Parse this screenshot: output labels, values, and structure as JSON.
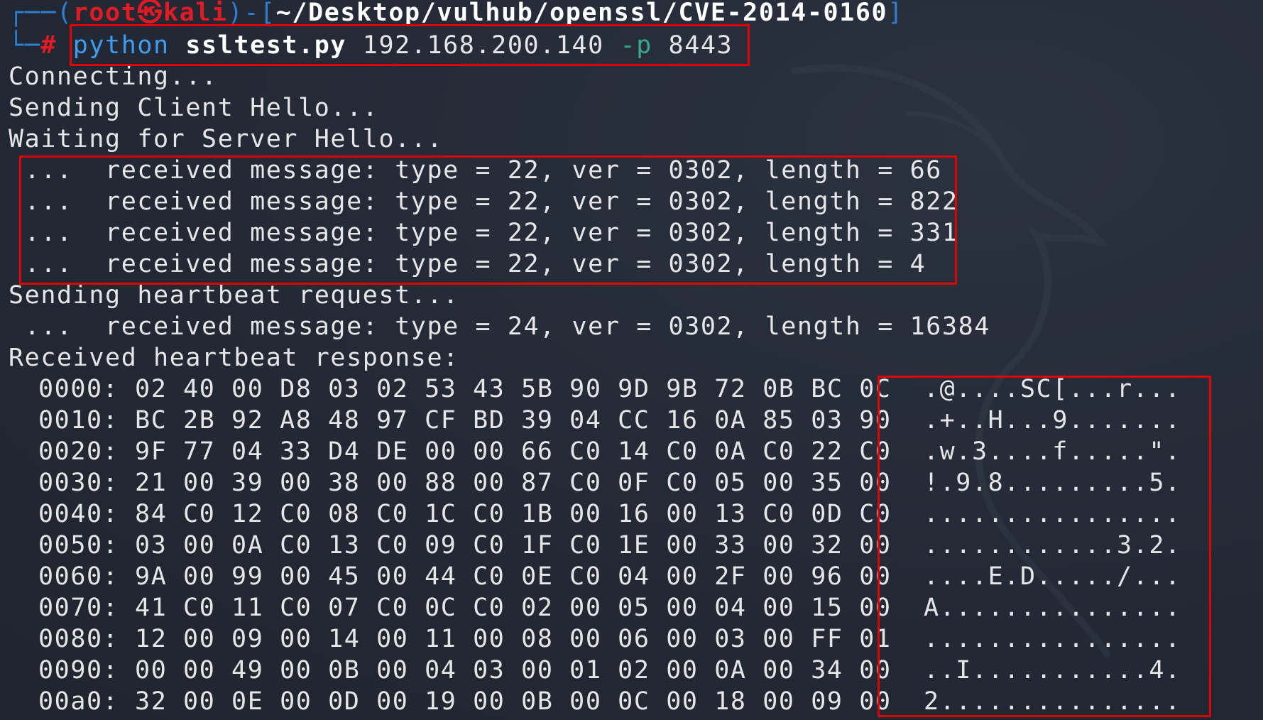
{
  "prompt": {
    "corner_top": "┌──(",
    "user_host": "root㉿kali",
    "bracket_sep": ")-[",
    "cwd": "~/Desktop/vulhub/openssl/CVE-2014-0160",
    "bracket_end": "]",
    "corner_bottom": "└─",
    "hash": "#",
    "command": "python",
    "script": "ssltest.py",
    "target": "192.168.200.140",
    "flag": "-p",
    "port": "8443"
  },
  "output": {
    "connecting": "Connecting...",
    "client_hello": "Sending Client Hello...",
    "server_hello": "Waiting for Server Hello...",
    "received": [
      " ...  received message: type = 22, ver = 0302, length = 66",
      " ...  received message: type = 22, ver = 0302, length = 822",
      " ...  received message: type = 22, ver = 0302, length = 331",
      " ...  received message: type = 22, ver = 0302, length = 4"
    ],
    "heartbeat_request": "Sending heartbeat request...",
    "heartbeat_received": " ...  received message: type = 24, ver = 0302, length = 16384",
    "heartbeat_response": "Received heartbeat response:"
  },
  "hexdump": [
    {
      "offset": "0000:",
      "hex": "02 40 00 D8 03 02 53 43 5B 90 9D 9B 72 0B BC 0C",
      "ascii": ".@....SC[...r..."
    },
    {
      "offset": "0010:",
      "hex": "BC 2B 92 A8 48 97 CF BD 39 04 CC 16 0A 85 03 90",
      "ascii": ".+..H...9......."
    },
    {
      "offset": "0020:",
      "hex": "9F 77 04 33 D4 DE 00 00 66 C0 14 C0 0A C0 22 C0",
      "ascii": ".w.3....f.....\"."
    },
    {
      "offset": "0030:",
      "hex": "21 00 39 00 38 00 88 00 87 C0 0F C0 05 00 35 00",
      "ascii": "!.9.8.........5."
    },
    {
      "offset": "0040:",
      "hex": "84 C0 12 C0 08 C0 1C C0 1B 00 16 00 13 C0 0D C0",
      "ascii": "................"
    },
    {
      "offset": "0050:",
      "hex": "03 00 0A C0 13 C0 09 C0 1F C0 1E 00 33 00 32 00",
      "ascii": "............3.2."
    },
    {
      "offset": "0060:",
      "hex": "9A 00 99 00 45 00 44 C0 0E C0 04 00 2F 00 96 00",
      "ascii": "....E.D...../..."
    },
    {
      "offset": "0070:",
      "hex": "41 C0 11 C0 07 C0 0C C0 02 00 05 00 04 00 15 00",
      "ascii": "A..............."
    },
    {
      "offset": "0080:",
      "hex": "12 00 09 00 14 00 11 00 08 00 06 00 03 00 FF 01",
      "ascii": "................"
    },
    {
      "offset": "0090:",
      "hex": "00 00 49 00 0B 00 04 03 00 01 02 00 0A 00 34 00",
      "ascii": "..I...........4."
    },
    {
      "offset": "00a0:",
      "hex": "32 00 0E 00 0D 00 19 00 0B 00 0C 00 18 00 09 00",
      "ascii": "2..............."
    }
  ],
  "colors": {
    "background": "#232935",
    "text": "#e6e6e6",
    "prompt_blue": "#2e7fd1",
    "prompt_red": "#e01b24",
    "highlight_box": "#e00000"
  }
}
